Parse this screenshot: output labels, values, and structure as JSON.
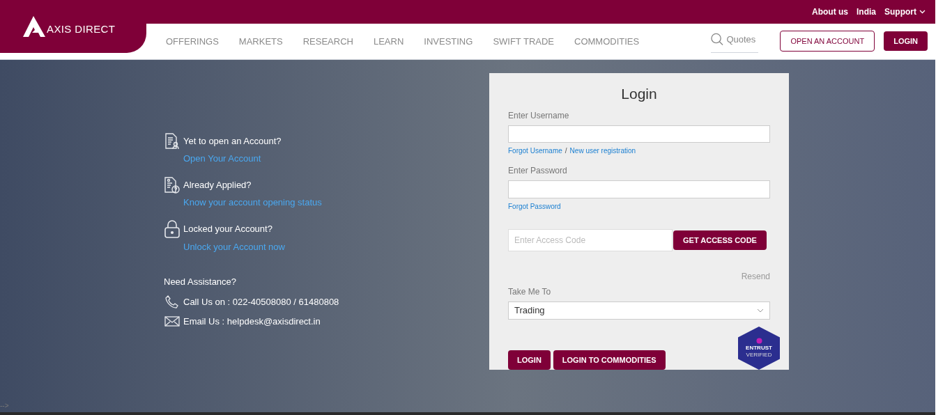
{
  "header": {
    "logo": "AXIS DIRECT",
    "top_links": [
      {
        "label": "About us"
      },
      {
        "label": "India"
      },
      {
        "label": "Support"
      }
    ],
    "nav": [
      {
        "label": "OFFERINGS"
      },
      {
        "label": "MARKETS"
      },
      {
        "label": "RESEARCH"
      },
      {
        "label": "LEARN"
      },
      {
        "label": "INVESTING"
      },
      {
        "label": "SWIFT TRADE"
      },
      {
        "label": "COMMODITIES"
      }
    ],
    "search": {
      "placeholder": "Quotes"
    },
    "open_account": "OPEN AN ACCOUNT",
    "login": "LOGIN"
  },
  "info": {
    "items": [
      {
        "kind": "document",
        "title": "Yet to open an Account?",
        "link": "Open Your Account"
      },
      {
        "kind": "status",
        "title": "Already Applied?",
        "link": "Know your account opening status"
      },
      {
        "kind": "lock",
        "title": "Locked your Account?",
        "link": "Unlock your Account now"
      }
    ],
    "assistance": {
      "title": "Need Assistance?",
      "contacts": [
        {
          "kind": "phone",
          "text": "Call Us on : 022-40508080 / 61480808"
        },
        {
          "kind": "email",
          "text": "Email Us : helpdesk@axisdirect.in"
        }
      ]
    }
  },
  "login_form": {
    "title": "Login",
    "username_label": "Enter Username",
    "forgot_username": "Forgot Username",
    "separator": "/",
    "new_user": "New user registration",
    "password_label": "Enter Password",
    "forgot_password": "Forgot Password",
    "access_code": {
      "placeholder": "Enter Access Code"
    },
    "get_access_code": "GET ACCESS CODE",
    "resend": "Resend",
    "take_me_to_label": "Take Me To",
    "take_me_to": "Trading",
    "buttons": [
      "LOGIN",
      "LOGIN TO COMMODITIES"
    ],
    "badge": {
      "name": "ENTRUST",
      "caption": "VERIFIED"
    }
  },
  "footer_mark": "-->"
}
